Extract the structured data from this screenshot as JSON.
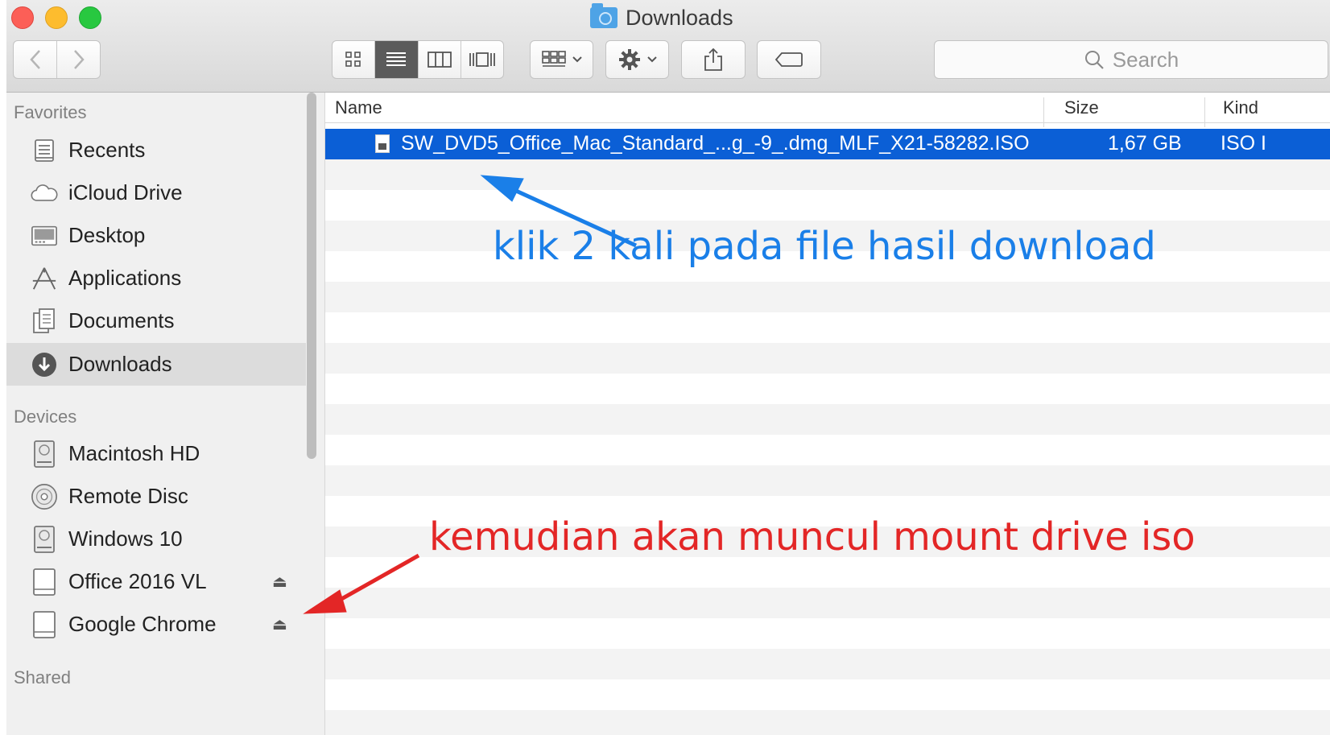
{
  "window": {
    "title": "Downloads"
  },
  "toolbar": {
    "search_placeholder": "Search",
    "view_buttons": [
      "icon-view",
      "list-view",
      "column-view",
      "coverflow-view"
    ],
    "active_view": "list-view"
  },
  "sidebar": {
    "favorites_heading": "Favorites",
    "favorites": [
      {
        "label": "Recents",
        "icon": "recents-icon"
      },
      {
        "label": "iCloud Drive",
        "icon": "cloud-icon"
      },
      {
        "label": "Desktop",
        "icon": "desktop-icon"
      },
      {
        "label": "Applications",
        "icon": "applications-icon"
      },
      {
        "label": "Documents",
        "icon": "documents-icon"
      },
      {
        "label": "Downloads",
        "icon": "downloads-icon",
        "selected": true
      }
    ],
    "devices_heading": "Devices",
    "devices": [
      {
        "label": "Macintosh HD",
        "icon": "hard-drive-icon"
      },
      {
        "label": "Remote Disc",
        "icon": "disc-icon"
      },
      {
        "label": "Windows 10",
        "icon": "hard-drive-icon"
      },
      {
        "label": "Office 2016 VL",
        "icon": "volume-icon",
        "eject": true
      },
      {
        "label": "Google Chrome",
        "icon": "volume-icon",
        "eject": true
      }
    ],
    "shared_heading": "Shared"
  },
  "columns": {
    "name": "Name",
    "size": "Size",
    "kind": "Kind"
  },
  "files": [
    {
      "name": "SW_DVD5_Office_Mac_Standard_...g_-9_.dmg_MLF_X21-58282.ISO",
      "size": "1,67 GB",
      "kind": "ISO I",
      "selected": true
    }
  ],
  "annotations": {
    "blue_text": "klik 2 kali pada file hasil download",
    "red_text": "kemudian akan muncul mount drive iso",
    "blue_color": "#1a7fe8",
    "red_color": "#e32626"
  },
  "colors": {
    "selection": "#0b5fd6"
  }
}
